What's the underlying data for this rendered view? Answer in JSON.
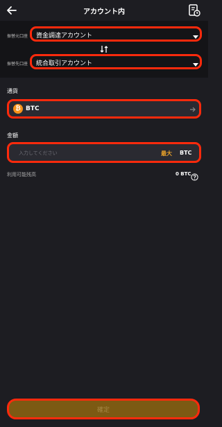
{
  "header": {
    "title": "アカウント内",
    "back_icon": "back-arrow-icon",
    "history_icon": "transfer-history-icon"
  },
  "transfer": {
    "from_label": "振替元口座",
    "from_value": "資金調達アカウント",
    "to_label": "振替先口座",
    "to_value": "統合取引アカウント",
    "swap_icon": "swap-arrows-icon"
  },
  "currency": {
    "label": "通貨",
    "coin_icon": "bitcoin-icon",
    "coin_symbol": "₿",
    "value": "BTC",
    "chevron_icon": "arrow-right-icon"
  },
  "amount": {
    "label": "金額",
    "placeholder": "入力してください",
    "max_label": "最大",
    "unit": "BTC"
  },
  "available": {
    "label": "利用可能残高",
    "value": "0 BTC",
    "help_icon": "help-circle-icon"
  },
  "confirm": {
    "label": "確定"
  },
  "colors": {
    "background": "#1d1d22",
    "highlight": "#ff2a0c",
    "accent": "#e8a22a",
    "bitcoin": "#f7931a",
    "confirm_bg": "#7c5a13"
  }
}
